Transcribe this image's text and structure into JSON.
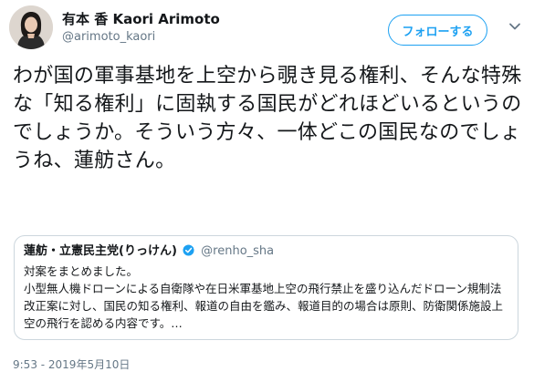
{
  "author": {
    "name": "有本 香 Kaori Arimoto",
    "handle": "@arimoto_kaori"
  },
  "follow_button": {
    "label": "フォローする"
  },
  "tweet": {
    "text": "わが国の軍事基地を上空から覗き見る権利、そんな特殊な「知る権利」に固執する国民がどれほどいるというのでしょうか。そういう方々、一体どこの国民なのでしょうね、蓮舫さん。",
    "timestamp": "9:53 - 2019年5月10日"
  },
  "quote": {
    "name": "蓮舫・立憲民主党(りっけん)",
    "handle": "@renho_sha",
    "text": "対案をまとめました。\n小型無人機ドローンによる自衛隊や在日米軍基地上空の飛行禁止を盛り込んだドローン規制法改正案に対し、国民の知る権利、報道の自由を鑑み、報道目的の場合は原則、防衛関係施設上空の飛行を認める内容です。…"
  },
  "colors": {
    "accent": "#1da1f2",
    "muted_text": "#657786",
    "border": "#ccd6dd"
  },
  "icons": [
    "avatar",
    "chevron-down-icon",
    "verified-icon"
  ]
}
